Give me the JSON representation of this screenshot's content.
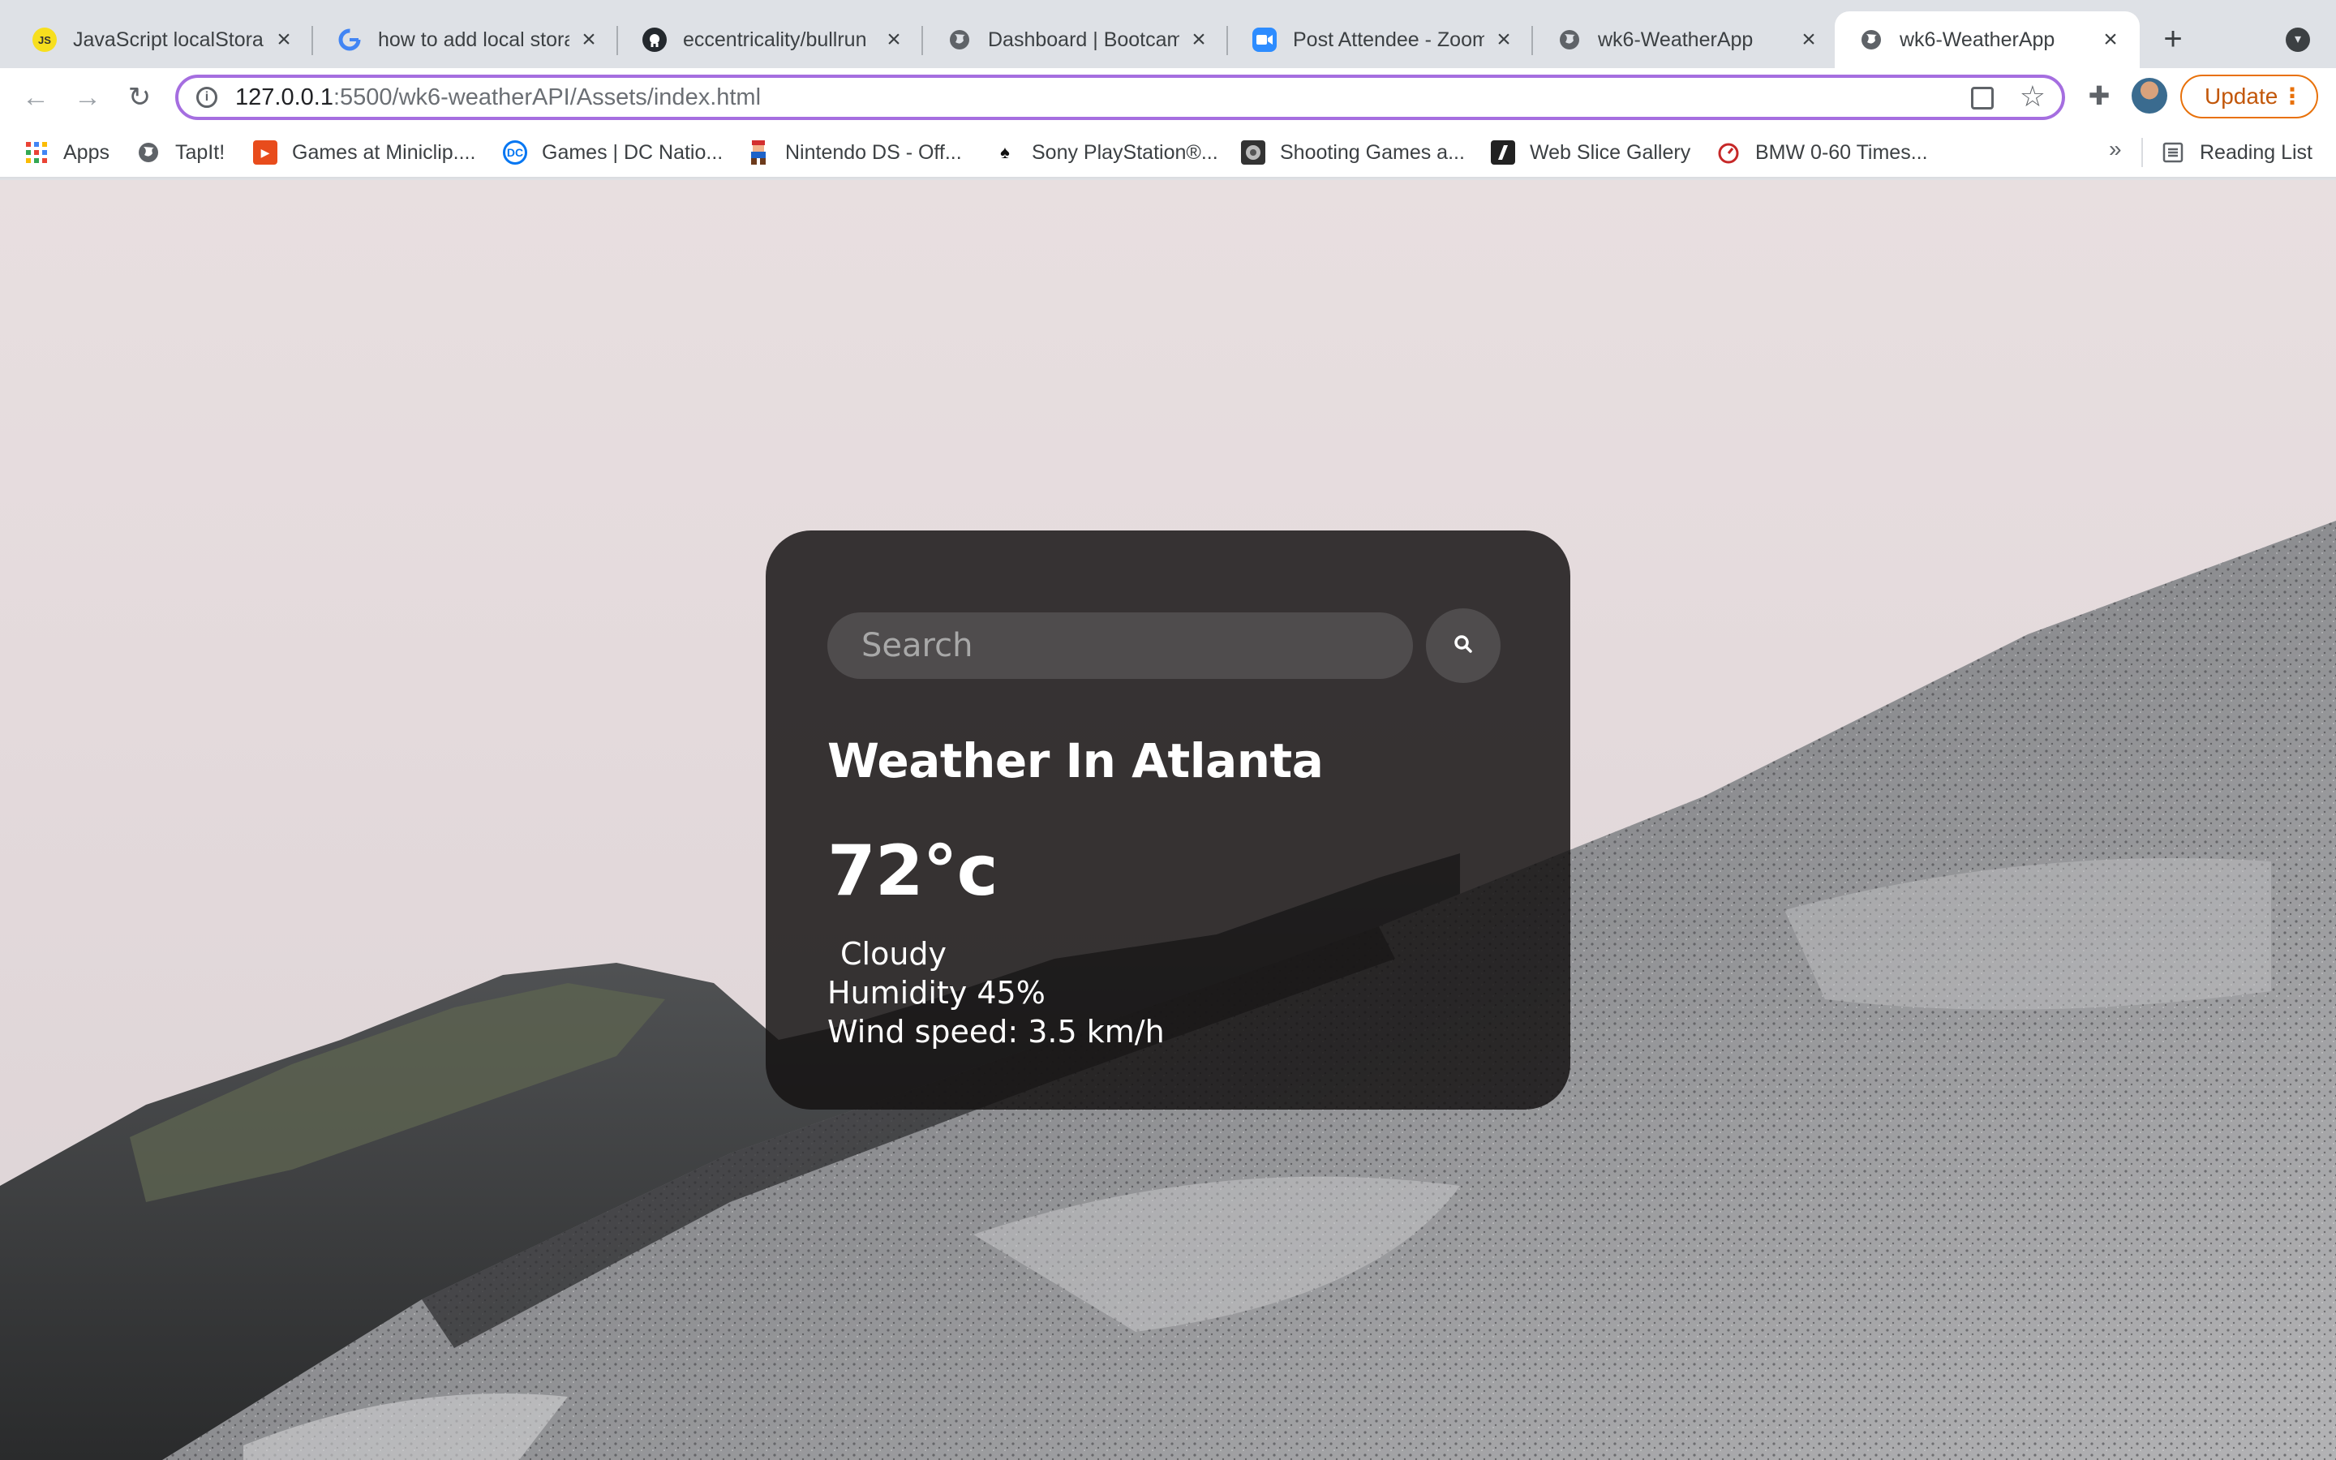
{
  "browser": {
    "tabs": [
      {
        "title": "JavaScript localStorage",
        "favicon": "js-icon",
        "active": false
      },
      {
        "title": "how to add local storage",
        "favicon": "google-icon",
        "active": false
      },
      {
        "title": "eccentricality/bullrun",
        "favicon": "github-icon",
        "active": false
      },
      {
        "title": "Dashboard | Bootcamp",
        "favicon": "globe-icon",
        "active": false
      },
      {
        "title": "Post Attendee - Zoom",
        "favicon": "zoom-icon",
        "active": false
      },
      {
        "title": "wk6-WeatherApp",
        "favicon": "globe-icon",
        "active": false
      },
      {
        "title": "wk6-WeatherApp",
        "favicon": "globe-icon",
        "active": true
      }
    ],
    "address": {
      "host": "127.0.0.1",
      "rest": ":5500/wk6-weatherAPI/Assets/index.html"
    },
    "update_label": "Update",
    "bookmarks": [
      {
        "label": "Apps",
        "icon": "apps-grid-icon"
      },
      {
        "label": "TapIt!",
        "icon": "globe-icon"
      },
      {
        "label": "Games at Miniclip....",
        "icon": "miniclip-icon"
      },
      {
        "label": "Games | DC Natio...",
        "icon": "dc-icon"
      },
      {
        "label": "Nintendo DS - Off...",
        "icon": "mario-icon"
      },
      {
        "label": "Sony PlayStation®...",
        "icon": "playstation-icon"
      },
      {
        "label": "Shooting Games a...",
        "icon": "shooting-icon"
      },
      {
        "label": "Web Slice Gallery",
        "icon": "webslice-icon"
      },
      {
        "label": "BMW 0-60 Times...",
        "icon": "stopwatch-icon"
      }
    ],
    "bookmarks_overflow": "»",
    "reading_list": "Reading List"
  },
  "weather": {
    "search_placeholder": "Search",
    "city_heading": "Weather In Atlanta",
    "temperature": "72°c",
    "description": "Cloudy",
    "humidity": "Humidity 45%",
    "wind": "Wind speed: 3.5 km/h"
  },
  "colors": {
    "card_bg": "#141212",
    "omnibox_focus": "#a56ee0",
    "update_accent": "#e8710a"
  }
}
